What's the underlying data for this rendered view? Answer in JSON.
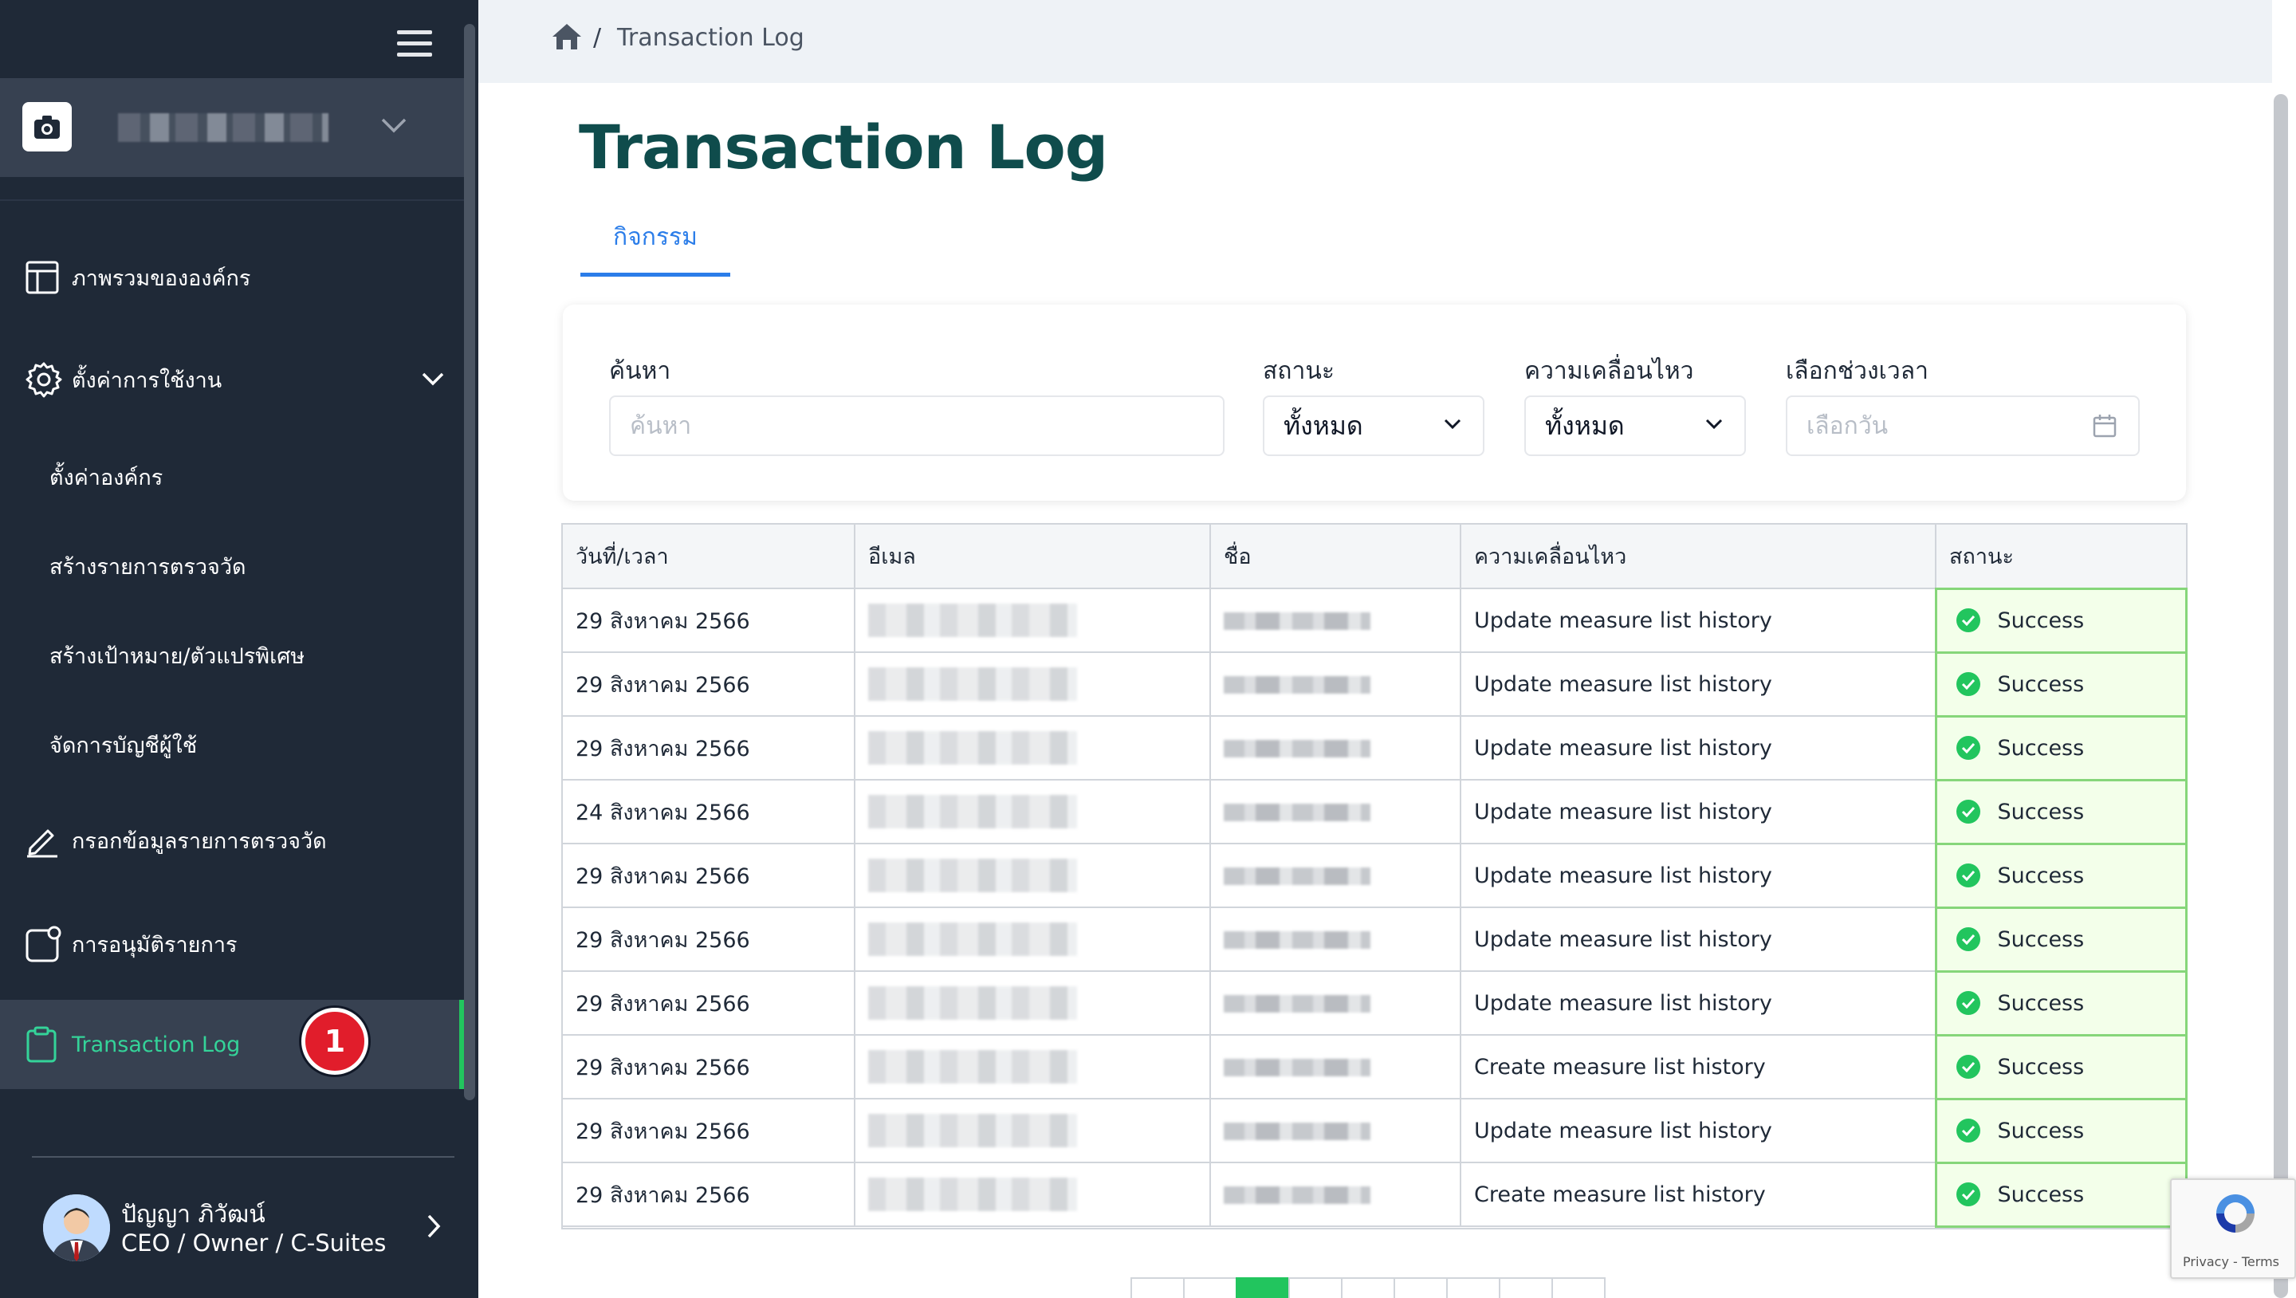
{
  "breadcrumb": {
    "separator": "/",
    "current": "Transaction Log"
  },
  "page": {
    "title": "Transaction Log",
    "tab": "กิจกรรม"
  },
  "sidebar": {
    "items": [
      {
        "label": "ภาพรวมขององค์กร",
        "icon": "layout-icon"
      },
      {
        "label": "ตั้งค่าการใช้งาน",
        "icon": "gear-icon"
      },
      {
        "label": "ตั้งค่าองค์กร"
      },
      {
        "label": "สร้างรายการตรวจวัด"
      },
      {
        "label": "สร้างเป้าหมาย/ตัวแปรพิเศษ"
      },
      {
        "label": "จัดการบัญชีผู้ใช้"
      },
      {
        "label": "กรอกข้อมูลรายการตรวจวัด",
        "icon": "pencil-icon"
      },
      {
        "label": "การอนุมัติรายการ",
        "icon": "approval-icon"
      },
      {
        "label": "Transaction Log",
        "icon": "clipboard-icon"
      }
    ],
    "badge": "1",
    "user": {
      "name": "ปัญญา ภิวัฒน์",
      "role": "CEO / Owner / C-Suites"
    }
  },
  "filters": {
    "search_label": "ค้นหา",
    "search_placeholder": "ค้นหา",
    "status_label": "สถานะ",
    "status_value": "ทั้งหมด",
    "movement_label": "ความเคลื่อนไหว",
    "movement_value": "ทั้งหมด",
    "date_label": "เลือกช่วงเวลา",
    "date_placeholder": "เลือกวัน"
  },
  "table": {
    "headers": [
      "วันที่/เวลา",
      "อีเมล",
      "ชื่อ",
      "ความเคลื่อนไหว",
      "สถานะ"
    ],
    "rows": [
      {
        "date": "29 สิงหาคม 2566",
        "action": "Update measure list history",
        "status": "Success"
      },
      {
        "date": "29 สิงหาคม 2566",
        "action": "Update measure list history",
        "status": "Success"
      },
      {
        "date": "29 สิงหาคม 2566",
        "action": "Update measure list history",
        "status": "Success"
      },
      {
        "date": "24 สิงหาคม 2566",
        "action": "Update measure list history",
        "status": "Success"
      },
      {
        "date": "29 สิงหาคม 2566",
        "action": "Update measure list history",
        "status": "Success"
      },
      {
        "date": "29 สิงหาคม 2566",
        "action": "Update measure list history",
        "status": "Success"
      },
      {
        "date": "29 สิงหาคม 2566",
        "action": "Update measure list history",
        "status": "Success"
      },
      {
        "date": "29 สิงหาคม 2566",
        "action": "Create measure list history",
        "status": "Success"
      },
      {
        "date": "29 สิงหาคม 2566",
        "action": "Update measure list history",
        "status": "Success"
      },
      {
        "date": "29 สิงหาคม 2566",
        "action": "Create measure list history",
        "status": "Success"
      }
    ]
  },
  "recaptcha": {
    "text": "Privacy - Terms"
  },
  "colors": {
    "sidebar": "#1f2937",
    "accent": "#22c55e",
    "link": "#2b7de9",
    "title": "#0f4c4c"
  }
}
